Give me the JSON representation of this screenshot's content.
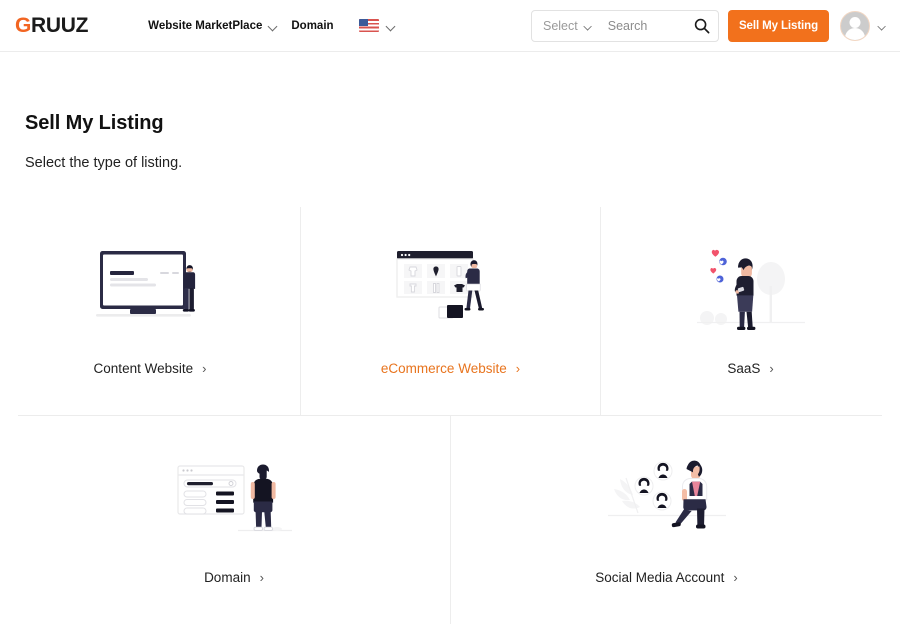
{
  "brand": {
    "logo_prefix": "G",
    "logo_rest": "RUUZ",
    "accent_color": "#F2711C",
    "logo_accent": "#F26522"
  },
  "header": {
    "nav": [
      {
        "label": "Website MarketPlace",
        "has_caret": true
      },
      {
        "label": "Domain",
        "has_caret": false
      }
    ],
    "locale": {
      "flag": "us-flag-icon",
      "has_caret": true
    },
    "search": {
      "select_label": "Select",
      "placeholder": "Search",
      "value": "",
      "icon": "search-icon"
    },
    "sell_button": "Sell My Listing",
    "avatar": {
      "icon": "avatar-icon",
      "has_caret": true
    }
  },
  "main": {
    "title": "Sell My Listing",
    "subtitle": "Select the type of listing.",
    "cards": [
      {
        "label": "Content Website",
        "chevron": "›",
        "illustration": "content-website-illustration",
        "active": false
      },
      {
        "label": "eCommerce Website",
        "chevron": "›",
        "illustration": "ecommerce-website-illustration",
        "active": true
      },
      {
        "label": "SaaS",
        "chevron": "›",
        "illustration": "saas-illustration",
        "active": false
      },
      {
        "label": "Domain",
        "chevron": "›",
        "illustration": "domain-illustration",
        "active": false
      },
      {
        "label": "Social Media Account",
        "chevron": "›",
        "illustration": "social-media-illustration",
        "active": false
      }
    ]
  }
}
